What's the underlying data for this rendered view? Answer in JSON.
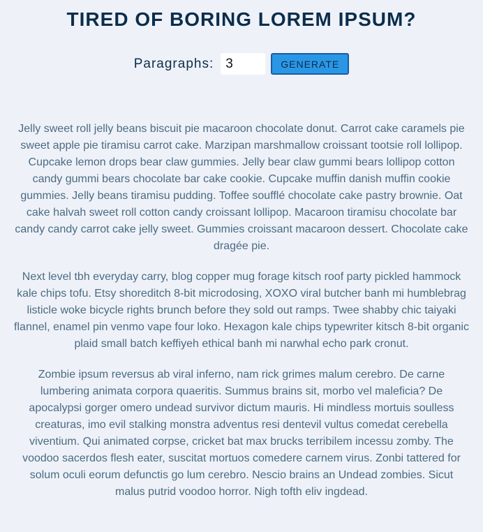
{
  "header": {
    "title": "TIRED OF BORING LOREM IPSUM?"
  },
  "controls": {
    "paragraphs_label": "Paragraphs:",
    "paragraphs_value": "3",
    "generate_label": "GENERATE"
  },
  "paragraphs": [
    "Jelly sweet roll jelly beans biscuit pie macaroon chocolate donut. Carrot cake caramels pie sweet apple pie tiramisu carrot cake. Marzipan marshmallow croissant tootsie roll lollipop. Cupcake lemon drops bear claw gummies. Jelly bear claw gummi bears lollipop cotton candy gummi bears chocolate bar cake cookie. Cupcake muffin danish muffin cookie gummies. Jelly beans tiramisu pudding. Toffee soufflé chocolate cake pastry brownie. Oat cake halvah sweet roll cotton candy croissant lollipop. Macaroon tiramisu chocolate bar candy candy carrot cake jelly sweet. Gummies croissant macaroon dessert. Chocolate cake dragée pie.",
    "Next level tbh everyday carry, blog copper mug forage kitsch roof party pickled hammock kale chips tofu. Etsy shoreditch 8-bit microdosing, XOXO viral butcher banh mi humblebrag listicle woke bicycle rights brunch before they sold out ramps. Twee shabby chic taiyaki flannel, enamel pin venmo vape four loko. Hexagon kale chips typewriter kitsch 8-bit organic plaid small batch keffiyeh ethical banh mi narwhal echo park cronut.",
    "Zombie ipsum reversus ab viral inferno, nam rick grimes malum cerebro. De carne lumbering animata corpora quaeritis. Summus brains sit, morbo vel maleficia? De apocalypsi gorger omero undead survivor dictum mauris. Hi mindless mortuis soulless creaturas, imo evil stalking monstra adventus resi dentevil vultus comedat cerebella viventium. Qui animated corpse, cricket bat max brucks terribilem incessu zomby. The voodoo sacerdos flesh eater, suscitat mortuos comedere carnem virus. Zonbi tattered for solum oculi eorum defunctis go lum cerebro. Nescio brains an Undead zombies. Sicut malus putrid voodoo horror. Nigh tofth eliv ingdead."
  ]
}
